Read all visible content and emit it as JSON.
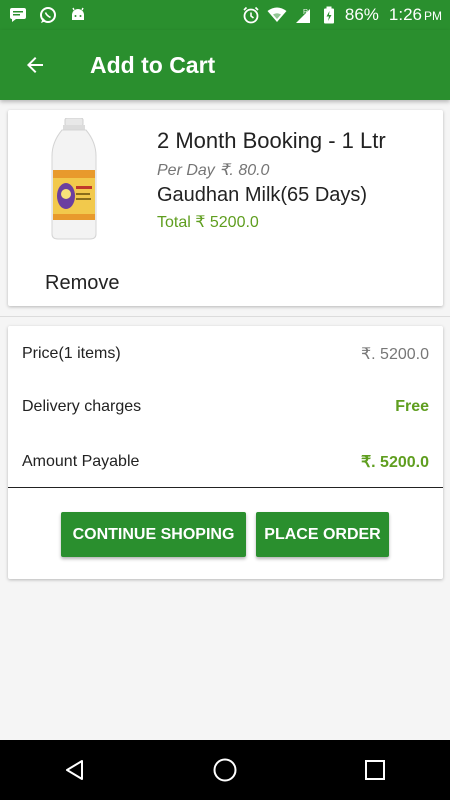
{
  "status_bar": {
    "battery": "86%",
    "time": "1:26",
    "ampm": "PM",
    "icons": [
      "message-icon",
      "whatsapp-icon",
      "android-icon",
      "alarm-icon",
      "wifi-icon",
      "signal-icon",
      "battery-icon"
    ]
  },
  "app_bar": {
    "title": "Add to Cart",
    "back_icon": "arrow-back-icon",
    "color": "#2a8f2e"
  },
  "cart_item": {
    "title": "2 Month Booking - 1 Ltr",
    "per_day": "Per Day ₹. 80.0",
    "name": "Gaudhan Milk(65 Days)",
    "total": "Total ₹ 5200.0",
    "remove_label": "Remove",
    "image": "milk-bottle-image"
  },
  "summary": {
    "price_label": "Price(1 items)",
    "price_value": "₹. 5200.0",
    "delivery_label": "Delivery charges",
    "delivery_value": "Free",
    "payable_label": "Amount Payable",
    "payable_value": "₹. 5200.0"
  },
  "buttons": {
    "continue": "CONTINUE SHOPING",
    "place_order": "PLACE ORDER"
  },
  "nav_bar": {
    "icons": [
      "back-triangle-icon",
      "home-circle-icon",
      "recents-square-icon"
    ]
  },
  "colors": {
    "primary": "#2a8f2e",
    "accent_green": "#5f9e1f"
  }
}
